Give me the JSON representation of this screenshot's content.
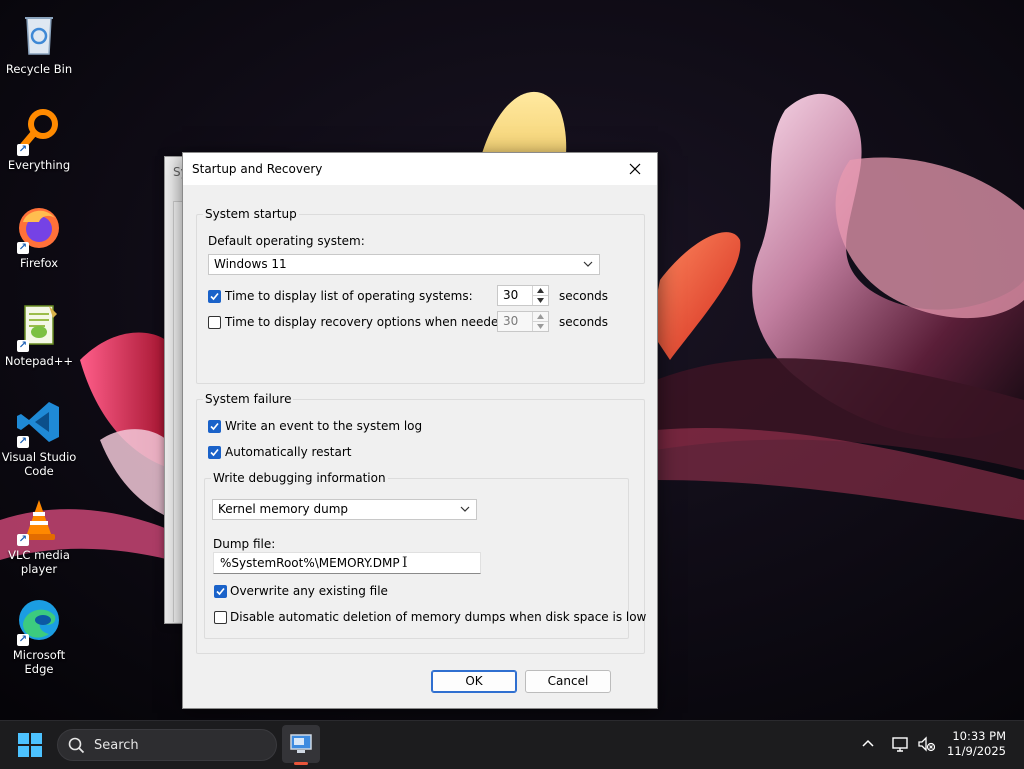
{
  "desktop": {
    "icons": [
      {
        "label": "Recycle Bin",
        "icon": "recycle-bin-icon"
      },
      {
        "label": "Everything",
        "icon": "everything-search-icon"
      },
      {
        "label": "Firefox",
        "icon": "firefox-icon"
      },
      {
        "label": "Notepad++",
        "icon": "notepad-plus-plus-icon"
      },
      {
        "label": "Visual Studio Code",
        "icon": "vscode-icon"
      },
      {
        "label": "VLC media player",
        "icon": "vlc-icon"
      },
      {
        "label": "Microsoft Edge",
        "icon": "edge-icon"
      }
    ]
  },
  "background_window": {
    "title_fragment": "Sy",
    "tab_fragment": "C"
  },
  "dialog": {
    "title": "Startup and Recovery",
    "system_startup": {
      "group_label": "System startup",
      "default_os_label": "Default operating system:",
      "default_os_value": "Windows 11",
      "display_list": {
        "checked": true,
        "label": "Time to display list of operating systems:",
        "value": "30",
        "unit": "seconds"
      },
      "display_recovery": {
        "checked": false,
        "label": "Time to display recovery options when needed:",
        "value": "30",
        "unit": "seconds"
      }
    },
    "system_failure": {
      "group_label": "System failure",
      "write_event": {
        "checked": true,
        "label": "Write an event to the system log"
      },
      "auto_restart": {
        "checked": true,
        "label": "Automatically restart"
      },
      "debug_info": {
        "group_label": "Write debugging information",
        "dump_type": "Kernel memory dump",
        "dump_file_label": "Dump file:",
        "dump_file_value": "%SystemRoot%\\MEMORY.DMP",
        "overwrite": {
          "checked": true,
          "label": "Overwrite any existing file"
        },
        "disable_auto_delete": {
          "checked": false,
          "label": "Disable automatic deletion of memory dumps when disk space is low"
        }
      }
    },
    "ok_label": "OK",
    "cancel_label": "Cancel"
  },
  "taskbar": {
    "search_placeholder": "Search",
    "time": "10:33 PM",
    "date": "11/9/2025"
  },
  "colors": {
    "accent": "#1a62c9",
    "taskbar": "#1c1c1e",
    "dialog": "#f0f0f0"
  }
}
